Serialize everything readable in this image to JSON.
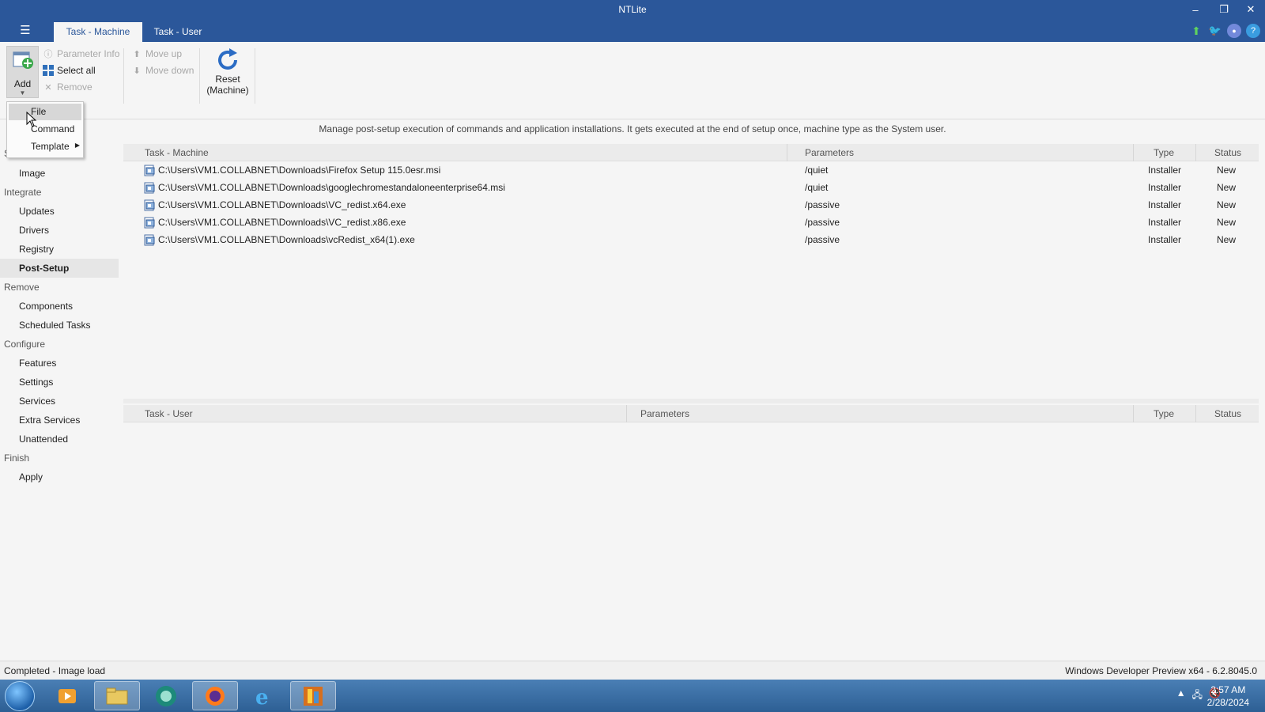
{
  "window": {
    "title": "NTLite",
    "minimize": "–",
    "maximize": "❐",
    "close": "✕"
  },
  "ribbon_tabs": [
    {
      "label": "Task - Machine"
    },
    {
      "label": "Task - User"
    }
  ],
  "ribbon": {
    "add": "Add",
    "parameter_info": "Parameter Info",
    "select_all": "Select all",
    "remove": "Remove",
    "move_up": "Move up",
    "move_down": "Move down",
    "reset_line1": "Reset",
    "reset_line2": "(Machine)"
  },
  "add_menu": {
    "items": [
      {
        "label": "File"
      },
      {
        "label": "Command"
      },
      {
        "label": "Template"
      }
    ]
  },
  "nav": {
    "partial_header": "S",
    "image": "Image",
    "integrate": "Integrate",
    "updates": "Updates",
    "drivers": "Drivers",
    "registry": "Registry",
    "post_setup": "Post-Setup",
    "remove": "Remove",
    "components": "Components",
    "scheduled_tasks": "Scheduled Tasks",
    "configure": "Configure",
    "features": "Features",
    "settings": "Settings",
    "services": "Services",
    "extra_services": "Extra Services",
    "unattended": "Unattended",
    "finish": "Finish",
    "apply": "Apply"
  },
  "description": "Manage post-setup execution of commands and application installations. It gets executed at the end of setup once, machine type as the System user.",
  "machine_grid": {
    "columns": {
      "task": "Task - Machine",
      "parameters": "Parameters",
      "type": "Type",
      "status": "Status"
    },
    "rows": [
      {
        "path": "C:\\Users\\VM1.COLLABNET\\Downloads\\Firefox Setup 115.0esr.msi",
        "params": "/quiet",
        "type": "Installer",
        "status": "New"
      },
      {
        "path": "C:\\Users\\VM1.COLLABNET\\Downloads\\googlechromestandaloneenterprise64.msi",
        "params": "/quiet",
        "type": "Installer",
        "status": "New"
      },
      {
        "path": "C:\\Users\\VM1.COLLABNET\\Downloads\\VC_redist.x64.exe",
        "params": "/passive",
        "type": "Installer",
        "status": "New"
      },
      {
        "path": "C:\\Users\\VM1.COLLABNET\\Downloads\\VC_redist.x86.exe",
        "params": "/passive",
        "type": "Installer",
        "status": "New"
      },
      {
        "path": "C:\\Users\\VM1.COLLABNET\\Downloads\\vcRedist_x64(1).exe",
        "params": "/passive",
        "type": "Installer",
        "status": "New"
      }
    ]
  },
  "user_grid": {
    "columns": {
      "task": "Task - User",
      "parameters": "Parameters",
      "type": "Type",
      "status": "Status"
    }
  },
  "statusbar": {
    "left": "Completed - Image load",
    "right": "Windows Developer Preview x64 - 6.2.8045.0"
  },
  "taskbar": {
    "time": "2:57 AM",
    "date": "2/28/2024"
  },
  "colors": {
    "accent": "#2b579a",
    "add_green": "#3aa84a"
  }
}
